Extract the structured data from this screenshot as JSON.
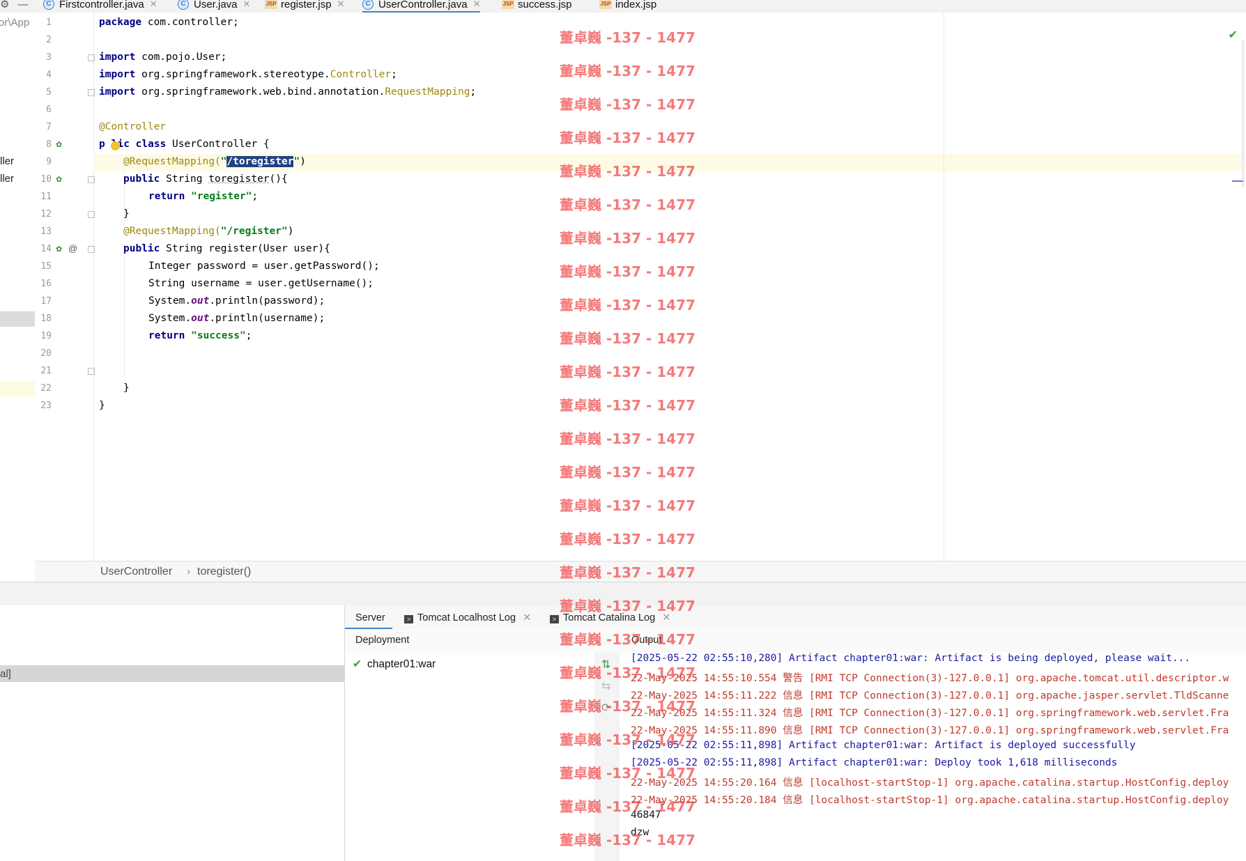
{
  "tabs": [
    {
      "label": "Firstcontroller.java",
      "type": "java"
    },
    {
      "label": "User.java",
      "type": "java"
    },
    {
      "label": "register.jsp",
      "type": "jsp"
    },
    {
      "label": "UserController.java",
      "type": "java",
      "active": true
    },
    {
      "label": "success.jsp",
      "type": "jsp"
    },
    {
      "label": "index.jsp",
      "type": "jsp"
    }
  ],
  "sidebar": {
    "path_fragment": "or\\App",
    "items": [
      "ller",
      "ller"
    ]
  },
  "editor": {
    "line_numbers": [
      "1",
      "2",
      "3",
      "4",
      "5",
      "6",
      "7",
      "8",
      "9",
      "10",
      "11",
      "12",
      "13",
      "14",
      "15",
      "16",
      "17",
      "18",
      "19",
      "20",
      "21",
      "22",
      "23"
    ],
    "lines": {
      "l1_kw": "package",
      "l1_rest": " com.controller;",
      "l3_kw": "import",
      "l3_rest": " com.pojo.User;",
      "l4_kw": "import",
      "l4_a": " org.springframework.stereotype.",
      "l4_ann": "Controller",
      "l4_end": ";",
      "l5_kw": "import",
      "l5_a": " org.springframework.web.bind.annotation.",
      "l5_ann": "RequestMapping",
      "l5_end": ";",
      "l7_ann": "@Controller",
      "l8_kw_a": "p",
      "l8_kw_b": "lic class",
      "l8_rest": " UserController {",
      "l9_ann": "@RequestMapping(",
      "l9_q1": "\"",
      "l9_sel": "/toregister",
      "l9_q2": "\"",
      "l9_end": ")",
      "l10_kw": "public",
      "l10_a": " String ",
      "l10_fn": "toregister",
      "l10_end": "(){",
      "l11_kw": "return",
      "l11_str": " \"register\"",
      "l11_end": ";",
      "l12": "}",
      "l13_ann": "@RequestMapping(",
      "l13_str": "\"/register\"",
      "l13_end": ")",
      "l14_kw": "public",
      "l14_rest": " String register(User user){",
      "l15": "Integer password = user.getPassword();",
      "l16": "String username = user.getUsername();",
      "l17_a": "System.",
      "l17_it": "out",
      "l17_b": ".println(password);",
      "l18_a": "System.",
      "l18_it": "out",
      "l18_b": ".println(username);",
      "l19_kw": "return",
      "l19_str": " \"success\"",
      "l19_end": ";",
      "l21": "}",
      "l22": "}"
    }
  },
  "breadcrumb": {
    "class": "UserController",
    "method": "toregister()"
  },
  "bottom_left": {
    "selected_fragment": "al]"
  },
  "server_tabs": [
    {
      "label": "Server"
    },
    {
      "label": "Tomcat Localhost Log"
    },
    {
      "label": "Tomcat Catalina Log"
    }
  ],
  "deployment": {
    "header": "Deployment",
    "item": "chapter01:war"
  },
  "output": {
    "header": "Output",
    "lines": [
      {
        "text": "[2025-05-22 02:55:10,280] Artifact chapter01:war: Artifact is being deployed, please wait...",
        "color": "blue"
      },
      {
        "text": "22-May-2025 14:55:10.554 警告 [RMI TCP Connection(3)-127.0.0.1] org.apache.tomcat.util.descriptor.w",
        "color": "red"
      },
      {
        "text": "22-May-2025 14:55:11.222 信息 [RMI TCP Connection(3)-127.0.0.1] org.apache.jasper.servlet.TldScanne",
        "color": "red"
      },
      {
        "text": "22-May-2025 14:55:11.324 信息 [RMI TCP Connection(3)-127.0.0.1] org.springframework.web.servlet.Fra",
        "color": "red"
      },
      {
        "text": "22-May-2025 14:55:11.890 信息 [RMI TCP Connection(3)-127.0.0.1] org.springframework.web.servlet.Fra",
        "color": "red"
      },
      {
        "text": "[2025-05-22 02:55:11,898] Artifact chapter01:war: Artifact is deployed successfully",
        "color": "blue"
      },
      {
        "text": "[2025-05-22 02:55:11,898] Artifact chapter01:war: Deploy took 1,618 milliseconds",
        "color": "blue"
      },
      {
        "text": "22-May-2025 14:55:20.164 信息 [localhost-startStop-1] org.apache.catalina.startup.HostConfig.deploy",
        "color": "red"
      },
      {
        "text": "22-May-2025 14:55:20.184 信息 [localhost-startStop-1] org.apache.catalina.startup.HostConfig.deploy",
        "color": "red"
      },
      {
        "text": "46847",
        "color": "black"
      },
      {
        "text": "dzw",
        "color": "black"
      }
    ]
  },
  "watermark": "董卓巍 -137 - 1477",
  "colors": {
    "keyword": "#000080",
    "annotation": "#9e880d",
    "string": "#067d17",
    "selection": "#214283",
    "log_blue": "#1a1aa6",
    "log_red": "#c0392b",
    "watermark": "#f04848"
  }
}
